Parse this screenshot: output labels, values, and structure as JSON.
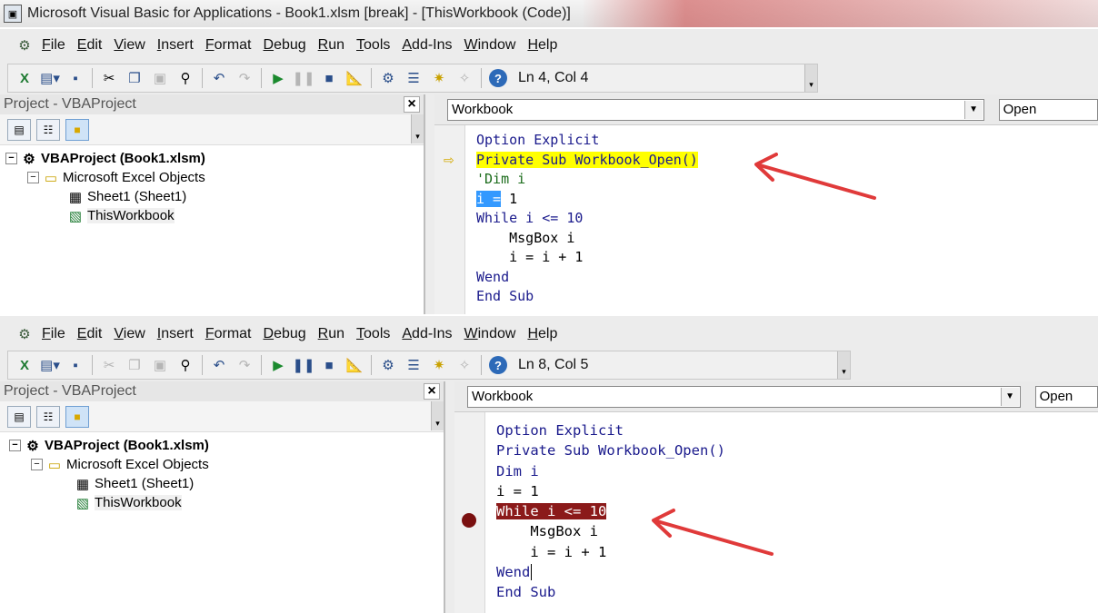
{
  "titlebar": {
    "title": "Microsoft Visual Basic for Applications - Book1.xlsm [break] - [ThisWorkbook (Code)]"
  },
  "menu": [
    "File",
    "Edit",
    "View",
    "Insert",
    "Format",
    "Debug",
    "Run",
    "Tools",
    "Add-Ins",
    "Window",
    "Help"
  ],
  "top": {
    "toolbar_position": "Ln 4, Col 4",
    "project": {
      "title": "Project - VBAProject",
      "close": "×",
      "tree": [
        {
          "label": "VBAProject (Book1.xlsm)",
          "level": 0
        },
        {
          "label": "Microsoft Excel Objects",
          "level": 1
        },
        {
          "label": "Sheet1 (Sheet1)",
          "level": 2
        },
        {
          "label": "ThisWorkbook",
          "level": 2
        }
      ]
    },
    "object_combo": "Workbook",
    "procedure_combo": "Open",
    "code": [
      "Option Explicit",
      "Private Sub Workbook_Open()",
      "'Dim i",
      "i = 1",
      "While i <= 10",
      "    MsgBox i",
      "    i = i + 1",
      "Wend",
      "End Sub"
    ]
  },
  "bottom": {
    "toolbar_position": "Ln 8, Col 5",
    "project": {
      "title": "Project - VBAProject",
      "close": "×",
      "tree": [
        {
          "label": "VBAProject (Book1.xlsm)",
          "level": 0
        },
        {
          "label": "Microsoft Excel Objects",
          "level": 1
        },
        {
          "label": "Sheet1 (Sheet1)",
          "level": 2
        },
        {
          "label": "ThisWorkbook",
          "level": 2
        }
      ]
    },
    "object_combo": "Workbook",
    "procedure_combo": "Open",
    "code": [
      "Option Explicit",
      "Private Sub Workbook_Open()",
      "Dim i",
      "i = 1",
      "While i <= 10",
      "    MsgBox i",
      "    i = i + 1",
      "Wend",
      "End Sub"
    ]
  },
  "colors": {
    "highlight_yellow": "#ffff00",
    "breakpoint": "#8b1a1a",
    "arrow_red": "#e03a3a",
    "keyword_blue": "#1a1a8c"
  },
  "icons": [
    "vba-window-icon",
    "excel-icon",
    "insert-userform-icon",
    "save-icon",
    "cut-icon",
    "copy-icon",
    "paste-icon",
    "find-icon",
    "undo-icon",
    "redo-icon",
    "run-icon",
    "break-icon",
    "reset-icon",
    "design-mode-icon",
    "project-explorer-icon",
    "properties-icon",
    "object-browser-icon",
    "toolbox-icon",
    "help-icon"
  ]
}
